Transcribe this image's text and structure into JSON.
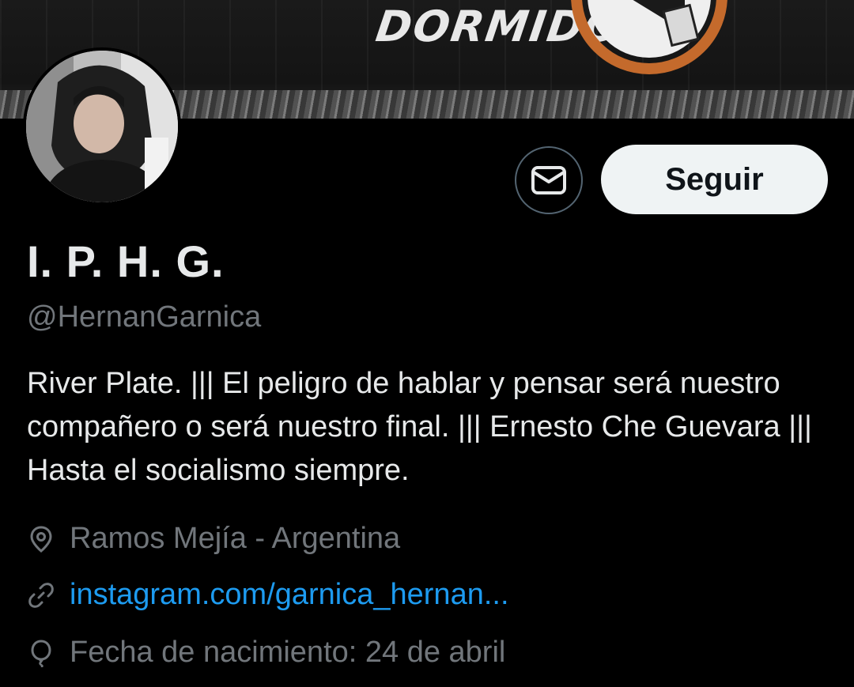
{
  "banner": {
    "text": "DORMIDO..."
  },
  "profile": {
    "display_name": "I. P. H. G.",
    "handle": "@HernanGarnica",
    "bio": "River Plate. ||| El peligro de hablar y pensar será nuestro compañero o será nuestro final. ||| Ernesto Che Guevara ||| Hasta el socialismo siempre.",
    "location": "Ramos Mejía -  Argentina",
    "link": "instagram.com/garnica_hernan...",
    "birthday": "Fecha de nacimiento: 24 de abril"
  },
  "actions": {
    "message_icon": "envelope-icon",
    "follow_label": "Seguir"
  },
  "icons": {
    "location": "map-pin-icon",
    "link": "link-icon",
    "birthday": "balloon-icon"
  },
  "colors": {
    "background": "#000000",
    "primary_text": "#e7e9ea",
    "secondary_text": "#71767b",
    "link": "#1d9bf0",
    "follow_button_bg": "#eff3f4",
    "follow_button_text": "#0f1419",
    "icon_border": "#536471"
  }
}
